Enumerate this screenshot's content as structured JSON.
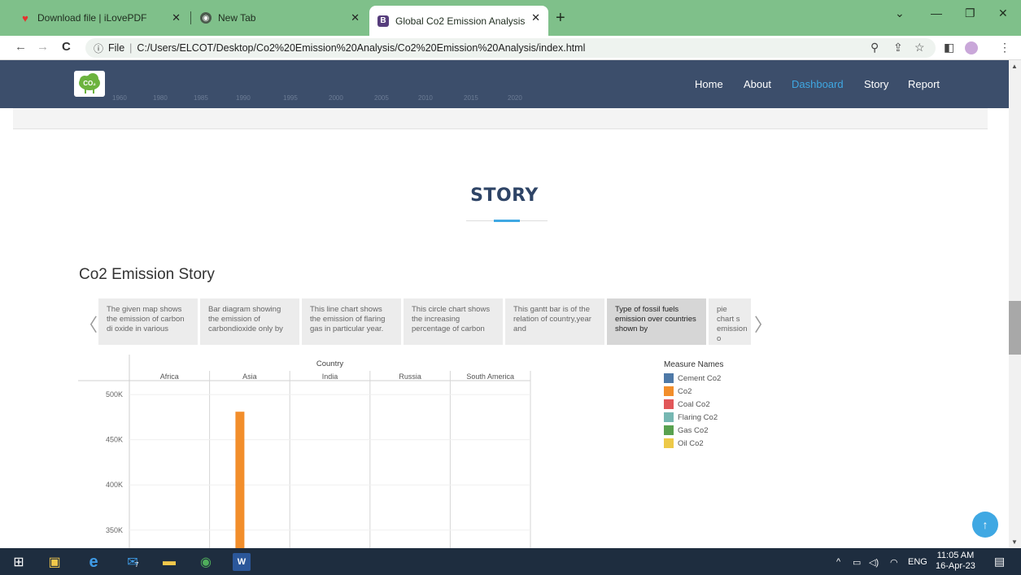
{
  "browser": {
    "tabs": [
      {
        "title": "Download file | iLovePDF",
        "active": false
      },
      {
        "title": "New Tab",
        "active": false
      },
      {
        "title": "Global Co2 Emission Analysis",
        "active": true
      }
    ],
    "address": {
      "scheme_label": "File",
      "url": "C:/Users/ELCOT/Desktop/Co2%20Emission%20Analysis/Co2%20Emission%20Analysis/index.html"
    }
  },
  "site": {
    "logo_text": "CO₂",
    "nav": [
      "Home",
      "About",
      "Dashboard",
      "Story",
      "Report"
    ],
    "active_nav": "Dashboard",
    "ghost_years": [
      "1960",
      "1980",
      "1985",
      "1990",
      "1995",
      "2000",
      "2005",
      "2010",
      "2015",
      "2020"
    ]
  },
  "story": {
    "section_title": "STORY",
    "heading": "Co2 Emission Story",
    "points": [
      "The given map shows the emission of carbon di oxide in various",
      "Bar diagram showing the emission of carbondioxide only by",
      "This line chart shows the emission of flaring gas in particular year.",
      "This circle chart shows the increasing percentage of carbon",
      "This gantt bar is of the relation of country,year and",
      "Type of fossil fuels emission over countries shown by",
      "pie chart s emission o carbon di"
    ],
    "selected_index": 5
  },
  "chart_data": {
    "type": "bar",
    "title": "",
    "column_header": "Country",
    "categories": [
      "Africa",
      "Asia",
      "India",
      "Russia",
      "South America"
    ],
    "y_ticks": [
      "500K",
      "450K",
      "400K",
      "350K"
    ],
    "ylim": [
      330000,
      510000
    ],
    "series": [
      {
        "name": "Cement Co2",
        "color": "#4e79a7",
        "values": [
          null,
          null,
          null,
          null,
          null
        ]
      },
      {
        "name": "Co2",
        "color": "#f28e2b",
        "values": [
          null,
          481000,
          null,
          null,
          null
        ]
      },
      {
        "name": "Coal Co2",
        "color": "#e15759",
        "values": [
          null,
          null,
          null,
          null,
          null
        ]
      },
      {
        "name": "Flaring Co2",
        "color": "#76b7b2",
        "values": [
          null,
          null,
          null,
          null,
          null
        ]
      },
      {
        "name": "Gas Co2",
        "color": "#59a14f",
        "values": [
          null,
          null,
          null,
          null,
          null
        ]
      },
      {
        "name": "Oil Co2",
        "color": "#edc948",
        "values": [
          null,
          null,
          null,
          null,
          null
        ]
      }
    ],
    "legend_title": "Measure Names",
    "legend_position": "right"
  },
  "taskbar": {
    "time": "11:05 AM",
    "date": "16-Apr-23",
    "lang": "ENG",
    "badge_mail": "7",
    "badge_notify": "7"
  },
  "colors": {
    "tab_strip": "#7fc08a",
    "site_header": "#3c4e6b",
    "accent": "#3fa8e3",
    "title": "#2e4466"
  }
}
